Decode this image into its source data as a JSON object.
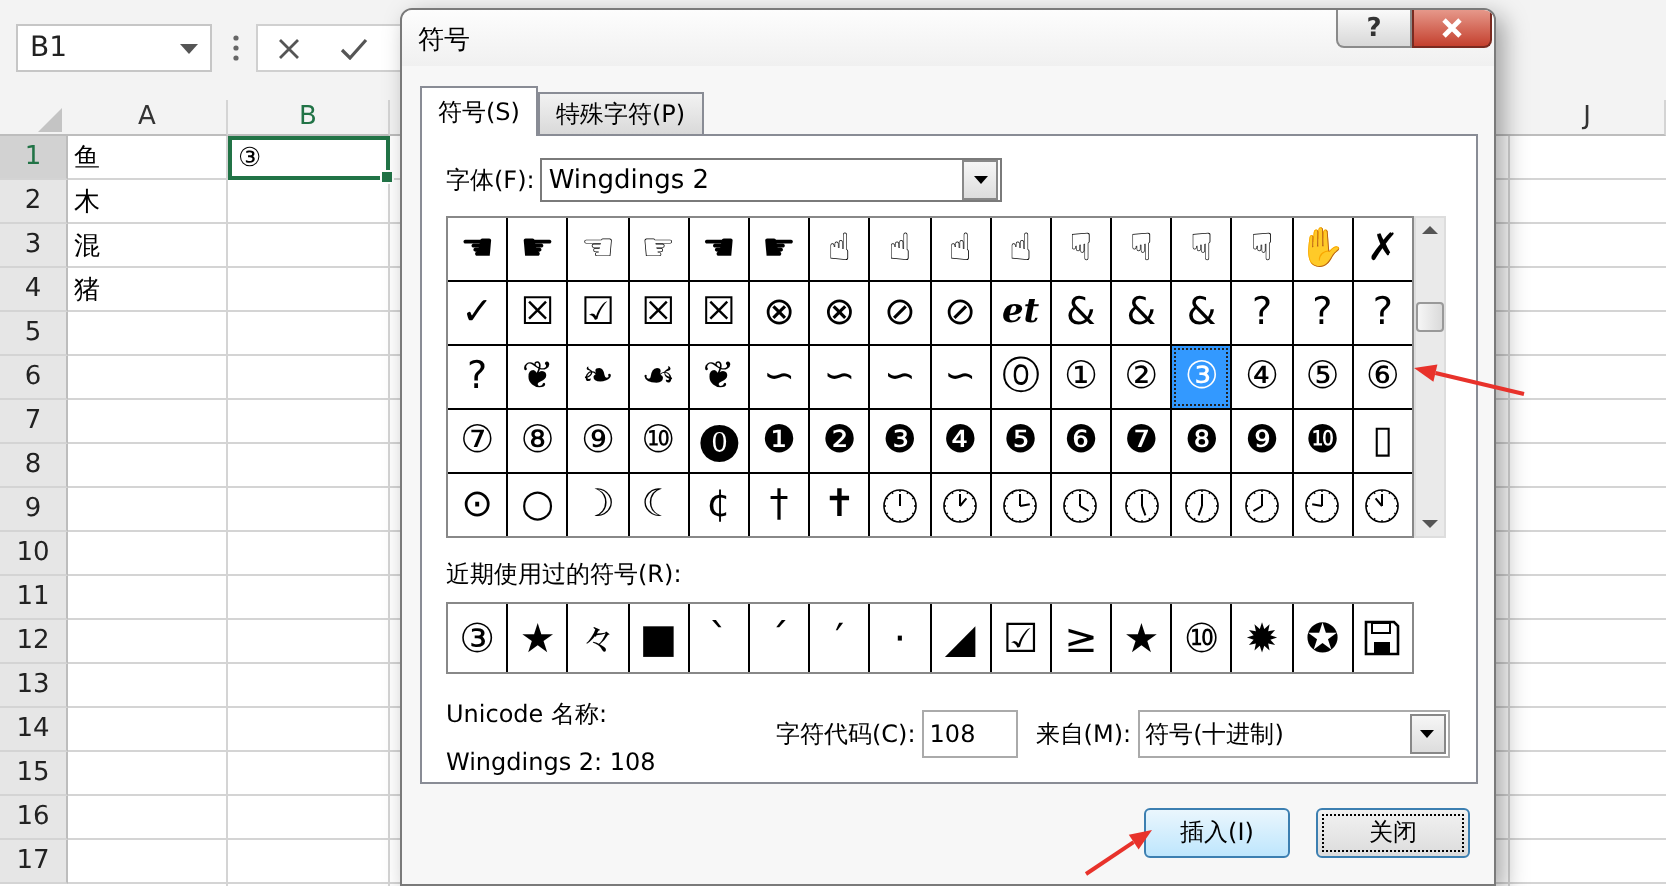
{
  "name_box": {
    "value": "B1"
  },
  "spreadsheet": {
    "columns": [
      {
        "label": "A",
        "selected": false
      },
      {
        "label": "B",
        "selected": true
      },
      {
        "label": "J",
        "selected": false
      }
    ],
    "rows": [
      {
        "number": "1",
        "selected": true,
        "cells": [
          {
            "text": "鱼",
            "selected": false
          },
          {
            "text": "③",
            "selected": true
          }
        ]
      },
      {
        "number": "2",
        "selected": false,
        "cells": [
          {
            "text": "木",
            "selected": false
          }
        ]
      },
      {
        "number": "3",
        "selected": false,
        "cells": [
          {
            "text": "混",
            "selected": false
          }
        ]
      },
      {
        "number": "4",
        "selected": false,
        "cells": [
          {
            "text": "猪",
            "selected": false
          }
        ]
      },
      {
        "number": "5",
        "selected": false
      },
      {
        "number": "6",
        "selected": false
      },
      {
        "number": "7",
        "selected": false
      },
      {
        "number": "8",
        "selected": false
      },
      {
        "number": "9",
        "selected": false
      },
      {
        "number": "10",
        "selected": false
      },
      {
        "number": "11",
        "selected": false
      },
      {
        "number": "12",
        "selected": false
      },
      {
        "number": "13",
        "selected": false
      },
      {
        "number": "14",
        "selected": false
      },
      {
        "number": "15",
        "selected": false
      },
      {
        "number": "16",
        "selected": false
      },
      {
        "number": "17",
        "selected": false
      }
    ]
  },
  "dialog": {
    "title": "符号",
    "help_button": "?",
    "tabs": [
      {
        "label": "符号(S)",
        "selected": true
      },
      {
        "label": "特殊字符(P)",
        "selected": false
      }
    ],
    "font_label": "字体(F):",
    "font_value": "Wingdings 2",
    "symbols": [
      {
        "kind": "glyph",
        "char": "☚",
        "selected": false
      },
      {
        "kind": "glyph",
        "char": "☛",
        "selected": false
      },
      {
        "kind": "glyph",
        "char": "☜",
        "selected": false
      },
      {
        "kind": "glyph",
        "char": "☞",
        "selected": false
      },
      {
        "kind": "glyph",
        "char": "☚",
        "selected": false
      },
      {
        "kind": "glyph",
        "char": "☛",
        "selected": false
      },
      {
        "kind": "glyph",
        "char": "☝",
        "selected": false
      },
      {
        "kind": "glyph",
        "char": "☝",
        "selected": false
      },
      {
        "kind": "glyph",
        "char": "☝",
        "selected": false
      },
      {
        "kind": "glyph",
        "char": "☝",
        "selected": false
      },
      {
        "kind": "glyph",
        "char": "☟",
        "selected": false
      },
      {
        "kind": "glyph",
        "char": "☟",
        "selected": false
      },
      {
        "kind": "glyph",
        "char": "☟",
        "selected": false
      },
      {
        "kind": "glyph",
        "char": "☟",
        "selected": false
      },
      {
        "kind": "glyph",
        "char": "✋",
        "selected": false
      },
      {
        "kind": "glyph",
        "char": "✗",
        "selected": false
      },
      {
        "kind": "glyph",
        "char": "✓",
        "selected": false
      },
      {
        "kind": "glyph",
        "char": "☒",
        "selected": false
      },
      {
        "kind": "glyph",
        "char": "☑",
        "selected": false
      },
      {
        "kind": "glyph",
        "char": "☒",
        "selected": false
      },
      {
        "kind": "glyph",
        "char": "☒",
        "selected": false
      },
      {
        "kind": "glyph",
        "char": "⊗",
        "selected": false
      },
      {
        "kind": "glyph",
        "char": "⊗",
        "selected": false
      },
      {
        "kind": "glyph",
        "char": "⊘",
        "selected": false
      },
      {
        "kind": "glyph",
        "char": "⊘",
        "selected": false
      },
      {
        "kind": "glyph",
        "char": "et",
        "selected": false
      },
      {
        "kind": "glyph",
        "char": "&",
        "selected": false
      },
      {
        "kind": "glyph",
        "char": "&",
        "selected": false
      },
      {
        "kind": "glyph",
        "char": "&",
        "selected": false
      },
      {
        "kind": "glyph",
        "char": "?",
        "selected": false
      },
      {
        "kind": "glyph",
        "char": "?",
        "selected": false
      },
      {
        "kind": "glyph",
        "char": "?",
        "selected": false
      },
      {
        "kind": "glyph",
        "char": "?",
        "selected": false
      },
      {
        "kind": "glyph",
        "char": "❦",
        "selected": false
      },
      {
        "kind": "glyph",
        "char": "❧",
        "selected": false
      },
      {
        "kind": "glyph",
        "char": "☙",
        "selected": false
      },
      {
        "kind": "glyph",
        "char": "❦",
        "selected": false
      },
      {
        "kind": "glyph",
        "char": "∽",
        "selected": false
      },
      {
        "kind": "glyph",
        "char": "∽",
        "selected": false
      },
      {
        "kind": "glyph",
        "char": "∽",
        "selected": false
      },
      {
        "kind": "glyph",
        "char": "∽",
        "selected": false
      },
      {
        "kind": "glyph",
        "char": "⓪",
        "selected": false
      },
      {
        "kind": "glyph",
        "char": "①",
        "selected": false
      },
      {
        "kind": "glyph",
        "char": "②",
        "selected": false
      },
      {
        "kind": "glyph",
        "char": "③",
        "selected": true
      },
      {
        "kind": "glyph",
        "char": "④",
        "selected": false
      },
      {
        "kind": "glyph",
        "char": "⑤",
        "selected": false
      },
      {
        "kind": "glyph",
        "char": "⑥",
        "selected": false
      },
      {
        "kind": "glyph",
        "char": "⑦",
        "selected": false
      },
      {
        "kind": "glyph",
        "char": "⑧",
        "selected": false
      },
      {
        "kind": "glyph",
        "char": "⑨",
        "selected": false
      },
      {
        "kind": "glyph",
        "char": "⑩",
        "selected": false
      },
      {
        "kind": "glyph",
        "char": "⓿",
        "selected": false
      },
      {
        "kind": "glyph",
        "char": "❶",
        "selected": false
      },
      {
        "kind": "glyph",
        "char": "❷",
        "selected": false
      },
      {
        "kind": "glyph",
        "char": "❸",
        "selected": false
      },
      {
        "kind": "glyph",
        "char": "❹",
        "selected": false
      },
      {
        "kind": "glyph",
        "char": "❺",
        "selected": false
      },
      {
        "kind": "glyph",
        "char": "❻",
        "selected": false
      },
      {
        "kind": "glyph",
        "char": "❼",
        "selected": false
      },
      {
        "kind": "glyph",
        "char": "❽",
        "selected": false
      },
      {
        "kind": "glyph",
        "char": "❾",
        "selected": false
      },
      {
        "kind": "glyph",
        "char": "❿",
        "selected": false
      },
      {
        "kind": "glyph",
        "char": "▯",
        "selected": false
      },
      {
        "kind": "glyph",
        "char": "⊙",
        "selected": false
      },
      {
        "kind": "glyph",
        "char": "○",
        "selected": false
      },
      {
        "kind": "glyph",
        "char": "☽",
        "selected": false
      },
      {
        "kind": "glyph",
        "char": "☾",
        "selected": false
      },
      {
        "kind": "glyph",
        "char": "¢",
        "selected": false
      },
      {
        "kind": "glyph",
        "char": "†",
        "selected": false
      },
      {
        "kind": "glyph",
        "char": "✝",
        "selected": false
      },
      {
        "kind": "clock",
        "selected": false
      },
      {
        "kind": "clock",
        "selected": false
      },
      {
        "kind": "clock",
        "selected": false
      },
      {
        "kind": "clock",
        "selected": false
      },
      {
        "kind": "clock",
        "selected": false
      },
      {
        "kind": "clock",
        "selected": false
      },
      {
        "kind": "clock",
        "selected": false
      },
      {
        "kind": "clock",
        "selected": false
      },
      {
        "kind": "clock",
        "selected": false
      }
    ],
    "recent_label": "近期使用过的符号(R):",
    "recent": [
      {
        "kind": "glyph",
        "char": "③"
      },
      {
        "kind": "glyph",
        "char": "★"
      },
      {
        "kind": "glyph",
        "char": "々"
      },
      {
        "kind": "glyph",
        "char": "■"
      },
      {
        "kind": "glyph",
        "char": "ˋ"
      },
      {
        "kind": "glyph",
        "char": "ˊ"
      },
      {
        "kind": "glyph",
        "char": "′"
      },
      {
        "kind": "glyph",
        "char": "·"
      },
      {
        "kind": "glyph",
        "char": "◢"
      },
      {
        "kind": "glyph",
        "char": "☑"
      },
      {
        "kind": "glyph",
        "char": "≥"
      },
      {
        "kind": "glyph",
        "char": "★"
      },
      {
        "kind": "glyph",
        "char": "⑩"
      },
      {
        "kind": "glyph",
        "char": "✹"
      },
      {
        "kind": "glyph",
        "char": "✪"
      },
      {
        "kind": "floppy"
      }
    ],
    "unicode_name_label": "Unicode 名称:",
    "unicode_name": "Wingdings 2: 108",
    "char_code_label": "字符代码(C):",
    "char_code": "108",
    "from_label": "来自(M):",
    "from_value": "符号(十进制)",
    "buttons": [
      {
        "label": "插入(I)",
        "kind": "default"
      },
      {
        "label": "关闭",
        "kind": "focused"
      }
    ]
  },
  "annotations": [
    {
      "kind": "arrow"
    },
    {
      "kind": "arrow"
    }
  ]
}
